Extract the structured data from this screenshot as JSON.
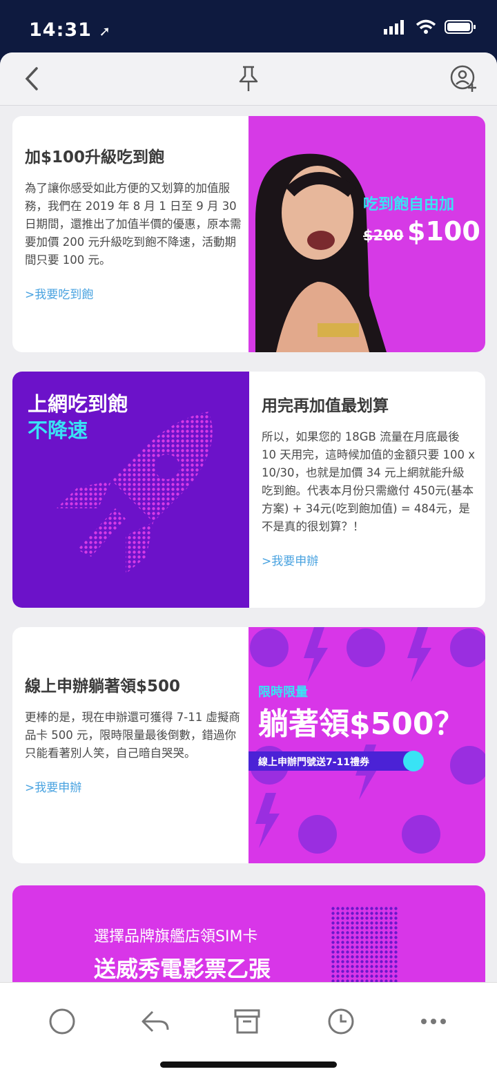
{
  "status": {
    "time": "14:31"
  },
  "cards": [
    {
      "title": "加$100升級吃到飽",
      "body": "為了讓你感受如此方便的又划算的加值服務，我們在 2019 年 8 月 1 日至 9 月 30 日期間，還推出了加值半價的優惠，原本需要加價 200 元升級吃到飽不降速，活動期間只要 100 元。",
      "link": ">我要吃到飽",
      "promo": {
        "headline": "吃到飽自由加",
        "old_price": "$200",
        "new_price": "$100"
      }
    },
    {
      "title": "用完再加值最划算",
      "body": "所以，如果您的 18GB 流量在月底最後 10 天用完，這時候加值的金額只要 100 x 10/30，也就是加價 34 元上網就能升級吃到飽。代表本月份只需繳付 450元(基本方案) + 34元(吃到飽加值) = 484元，是不是真的很划算？！",
      "link": ">我要申辦",
      "promo": {
        "line1": "上網吃到飽",
        "line2": "不降速"
      }
    },
    {
      "title": "線上申辦躺著領$500",
      "body": "更棒的是，現在申辦還可獲得 7-11 虛擬商品卡 500 元，限時限量最後倒數，錯過你只能看著別人笑，自己暗自哭哭。",
      "link": ">我要申辦",
      "promo": {
        "tag": "限時限量",
        "headline": "躺著領$500？",
        "ribbon": "線上申辦門號送7-11禮券"
      }
    }
  ],
  "banner": {
    "line1": "選擇品牌旗艦店領SIM卡",
    "line2": "送威秀電影票乙張"
  },
  "colors": {
    "accent_pink": "#d836e8",
    "accent_purple": "#6c12c9",
    "link_blue": "#4aa3e0",
    "cyan": "#39e3f5"
  },
  "icons": {
    "top": [
      "back-icon",
      "pin-icon",
      "add-contact-icon"
    ],
    "bottom": [
      "circle-icon",
      "reply-icon",
      "archive-icon",
      "clock-icon",
      "more-icon"
    ]
  }
}
